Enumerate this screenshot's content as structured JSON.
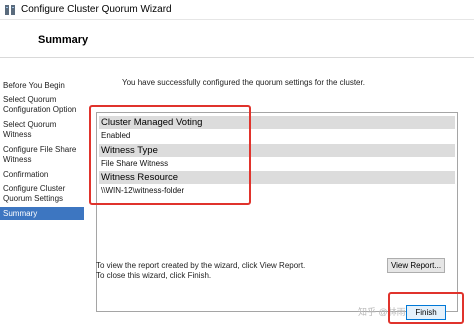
{
  "window": {
    "title": "Configure Cluster Quorum Wizard"
  },
  "header": {
    "heading": "Summary"
  },
  "nav": {
    "items": [
      {
        "label_lines": [
          "Before You Begin"
        ]
      },
      {
        "label_lines": [
          "Select Quorum",
          "Configuration Option"
        ]
      },
      {
        "label_lines": [
          "Select Quorum",
          "Witness"
        ]
      },
      {
        "label_lines": [
          "Configure File Share",
          "Witness"
        ]
      },
      {
        "label_lines": [
          "Confirmation"
        ]
      },
      {
        "label_lines": [
          "Configure Cluster",
          "Quorum Settings"
        ]
      },
      {
        "label_lines": [
          "Summary"
        ],
        "active": true
      }
    ]
  },
  "main": {
    "success_message": "You have successfully configured the quorum settings for the cluster.",
    "report": [
      {
        "header": "Cluster Managed Voting",
        "value": "Enabled"
      },
      {
        "header": "Witness Type",
        "value": "File Share Witness"
      },
      {
        "header": "Witness Resource",
        "value": "\\\\WIN-12\\witness-folder"
      }
    ],
    "view_report_hint": "To view the report created by the wizard, click View Report.",
    "close_hint": "To close this wizard, click Finish."
  },
  "buttons": {
    "view_report": "View Report...",
    "finish": "Finish"
  },
  "watermark": "知乎 @林雨鑫",
  "colors": {
    "highlight": "#e0332c",
    "nav_active": "#3d76c1",
    "group_header_bg": "#dcdcdc"
  }
}
